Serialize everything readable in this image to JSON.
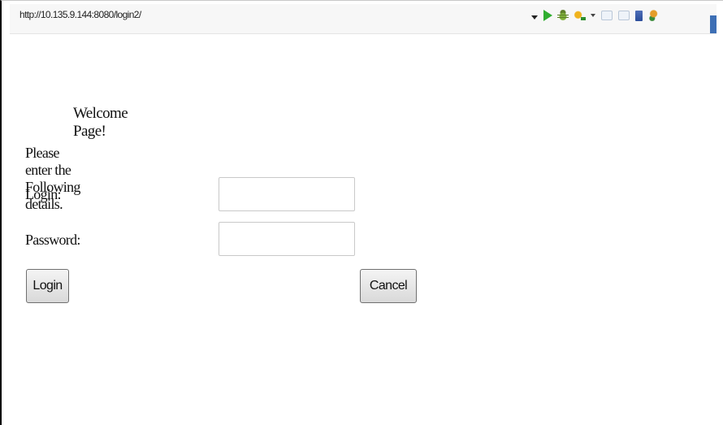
{
  "browser": {
    "url": "http://10.135.9.144:8080/login2/",
    "toolbar_icons": [
      "dropdown-caret-icon",
      "run-icon",
      "debug-icon",
      "external-tools-icon",
      "small-caret-icon",
      "back-arrow-icon",
      "forward-arrow-icon",
      "document-icon",
      "gears-icon"
    ]
  },
  "page": {
    "welcome": "Welcome Page!",
    "instructions": "Please enter the Following details.",
    "login_label": "Login:",
    "password_label": "Password:",
    "login_value": "",
    "password_value": "",
    "login_button": "Login",
    "cancel_button": "Cancel"
  },
  "colors": {
    "run_icon": "#2fae2f",
    "edge_tab": "#3d6fb5"
  }
}
